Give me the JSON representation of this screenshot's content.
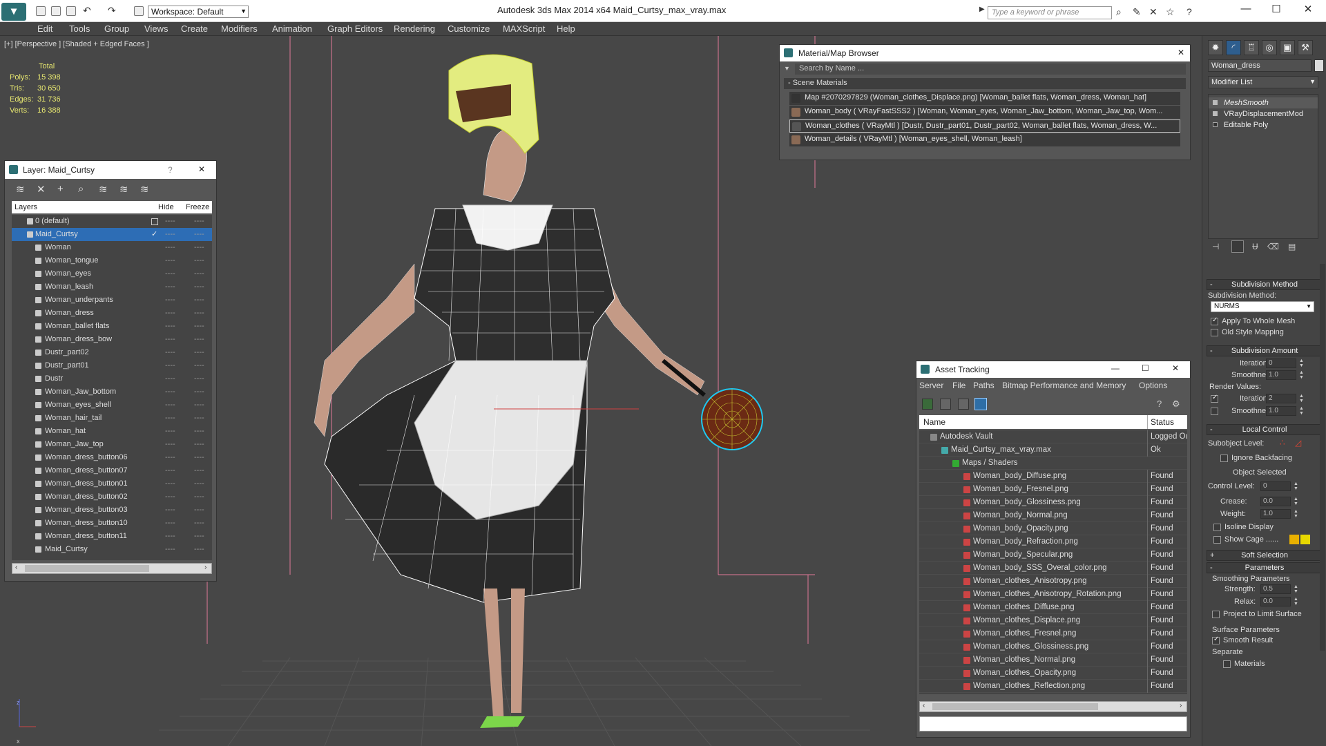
{
  "app": {
    "workspace": "Workspace: Default",
    "title": "Autodesk 3ds Max  2014 x64      Maid_Curtsy_max_vray.max",
    "search_placeholder": "Type a keyword or phrase"
  },
  "menu": [
    "Edit",
    "Tools",
    "Group",
    "Views",
    "Create",
    "Modifiers",
    "Animation",
    "Graph Editors",
    "Rendering",
    "Customize",
    "MAXScript",
    "Help"
  ],
  "viewport": {
    "label": "[+] [Perspective ] [Shaded + Edged Faces ]",
    "stats_header": "Total",
    "stats": [
      {
        "label": "Polys:",
        "value": "15 398"
      },
      {
        "label": "Tris:",
        "value": "30 650"
      },
      {
        "label": "Edges:",
        "value": "31 736"
      },
      {
        "label": "Verts:",
        "value": "16 388"
      }
    ],
    "axis_x": "x",
    "axis_z": "z"
  },
  "layers": {
    "title": "Layer: Maid_Curtsy",
    "help": "?",
    "close": "✕",
    "col_layers": "Layers",
    "col_hide": "Hide",
    "col_freeze": "Freeze",
    "rows": [
      {
        "name": "0 (default)"
      },
      {
        "name": "Maid_Curtsy"
      },
      {
        "name": "Woman"
      },
      {
        "name": "Woman_tongue"
      },
      {
        "name": "Woman_eyes"
      },
      {
        "name": "Woman_leash"
      },
      {
        "name": "Woman_underpants"
      },
      {
        "name": "Woman_dress"
      },
      {
        "name": "Woman_ballet flats"
      },
      {
        "name": "Woman_dress_bow"
      },
      {
        "name": "Dustr_part02"
      },
      {
        "name": "Dustr_part01"
      },
      {
        "name": "Dustr"
      },
      {
        "name": "Woman_Jaw_bottom"
      },
      {
        "name": "Woman_eyes_shell"
      },
      {
        "name": "Woman_hair_tail"
      },
      {
        "name": "Woman_hat"
      },
      {
        "name": "Woman_Jaw_top"
      },
      {
        "name": "Woman_dress_button06"
      },
      {
        "name": "Woman_dress_button07"
      },
      {
        "name": "Woman_dress_button01"
      },
      {
        "name": "Woman_dress_button02"
      },
      {
        "name": "Woman_dress_button03"
      },
      {
        "name": "Woman_dress_button10"
      },
      {
        "name": "Woman_dress_button11"
      },
      {
        "name": "Maid_Curtsy"
      }
    ],
    "dash": "----"
  },
  "material_browser": {
    "title": "Material/Map Browser",
    "search": "Search by Name ...",
    "section": "- Scene Materials",
    "rows": [
      "Map #2070297829 (Woman_clothes_Displace.png) [Woman_ballet flats, Woman_dress, Woman_hat]",
      "Woman_body  ( VRayFastSSS2 )  [Woman, Woman_eyes, Woman_Jaw_bottom, Woman_Jaw_top, Wom...",
      "Woman_clothes  ( VRayMtl )  [Dustr, Dustr_part01, Dustr_part02, Woman_ballet flats, Woman_dress, W...",
      "Woman_details  ( VRayMtl )  [Woman_eyes_shell, Woman_leash]"
    ]
  },
  "asset_tracking": {
    "title": "Asset Tracking",
    "menu": [
      "Server",
      "File",
      "Paths",
      "Bitmap Performance and Memory",
      "Options"
    ],
    "col_name": "Name",
    "col_status": "Status",
    "rows": [
      {
        "name": "Autodesk Vault",
        "status": "Logged Ou",
        "indent": 1
      },
      {
        "name": "Maid_Curtsy_max_vray.max",
        "status": "Ok",
        "indent": 2
      },
      {
        "name": "Maps / Shaders",
        "status": "",
        "indent": 3
      },
      {
        "name": "Woman_body_Diffuse.png",
        "status": "Found",
        "indent": 4
      },
      {
        "name": "Woman_body_Fresnel.png",
        "status": "Found",
        "indent": 4
      },
      {
        "name": "Woman_body_Glossiness.png",
        "status": "Found",
        "indent": 4
      },
      {
        "name": "Woman_body_Normal.png",
        "status": "Found",
        "indent": 4
      },
      {
        "name": "Woman_body_Opacity.png",
        "status": "Found",
        "indent": 4
      },
      {
        "name": "Woman_body_Refraction.png",
        "status": "Found",
        "indent": 4
      },
      {
        "name": "Woman_body_Specular.png",
        "status": "Found",
        "indent": 4
      },
      {
        "name": "Woman_body_SSS_Overal_color.png",
        "status": "Found",
        "indent": 4
      },
      {
        "name": "Woman_clothes_Anisotropy.png",
        "status": "Found",
        "indent": 4
      },
      {
        "name": "Woman_clothes_Anisotropy_Rotation.png",
        "status": "Found",
        "indent": 4
      },
      {
        "name": "Woman_clothes_Diffuse.png",
        "status": "Found",
        "indent": 4
      },
      {
        "name": "Woman_clothes_Displace.png",
        "status": "Found",
        "indent": 4
      },
      {
        "name": "Woman_clothes_Fresnel.png",
        "status": "Found",
        "indent": 4
      },
      {
        "name": "Woman_clothes_Glossiness.png",
        "status": "Found",
        "indent": 4
      },
      {
        "name": "Woman_clothes_Normal.png",
        "status": "Found",
        "indent": 4
      },
      {
        "name": "Woman_clothes_Opacity.png",
        "status": "Found",
        "indent": 4
      },
      {
        "name": "Woman_clothes_Reflection.png",
        "status": "Found",
        "indent": 4
      }
    ]
  },
  "command_panel": {
    "object_name": "Woman_dress",
    "modifier_list": "Modifier List",
    "stack": [
      "MeshSmooth",
      "VRayDisplacementMod",
      "Editable Poly"
    ],
    "subdivision_method_header": "Subdivision Method",
    "subdivision_method_label": "Subdivision Method:",
    "subdivision_method_value": "NURMS",
    "apply_whole_mesh": "Apply To Whole Mesh",
    "old_style_mapping": "Old Style Mapping",
    "subdivision_amount_header": "Subdivision Amount",
    "iterations_label": "Iterations:",
    "iterations_value": "0",
    "smoothness_label": "Smoothness:",
    "smoothness_value": "1.0",
    "render_values": "Render Values:",
    "render_iterations_value": "2",
    "render_smoothness_value": "1.0",
    "local_control_header": "Local Control",
    "subobject_level": "Subobject Level:",
    "ignore_backfacing": "Ignore Backfacing",
    "object_selected": "Object Selected",
    "control_level": "Control Level:",
    "control_level_value": "0",
    "crease": "Crease:",
    "crease_value": "0.0",
    "weight": "Weight:",
    "weight_value": "1.0",
    "isoline_display": "Isoline Display",
    "show_cage": "Show Cage ......",
    "soft_selection_header": "Soft Selection",
    "parameters_header": "Parameters",
    "smoothing_parameters": "Smoothing Parameters",
    "strength": "Strength:",
    "strength_value": "0.5",
    "relax": "Relax:",
    "relax_value": "0.0",
    "project_limit": "Project to Limit Surface",
    "surface_parameters": "Surface Parameters",
    "smooth_result": "Smooth Result",
    "separate": "Separate",
    "materials": "Materials"
  }
}
